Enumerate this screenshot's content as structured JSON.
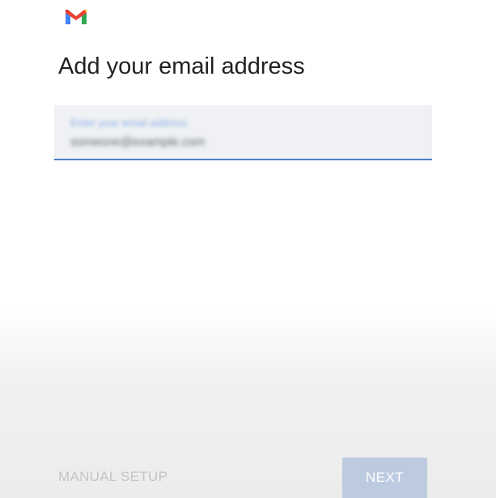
{
  "app": {
    "logo_icon": "gmail-logo-icon",
    "brand_colors": {
      "red": "#ea4335",
      "blue": "#4285f4",
      "green": "#34a853",
      "yellow": "#fbbc04"
    }
  },
  "page": {
    "title": "Add your email address"
  },
  "email_field": {
    "label": "Enter your email address",
    "value": "someone@example.com",
    "underline_color": "#4d7fc8"
  },
  "actions": {
    "manual_setup_label": "MANUAL SETUP",
    "next_label": "NEXT"
  }
}
